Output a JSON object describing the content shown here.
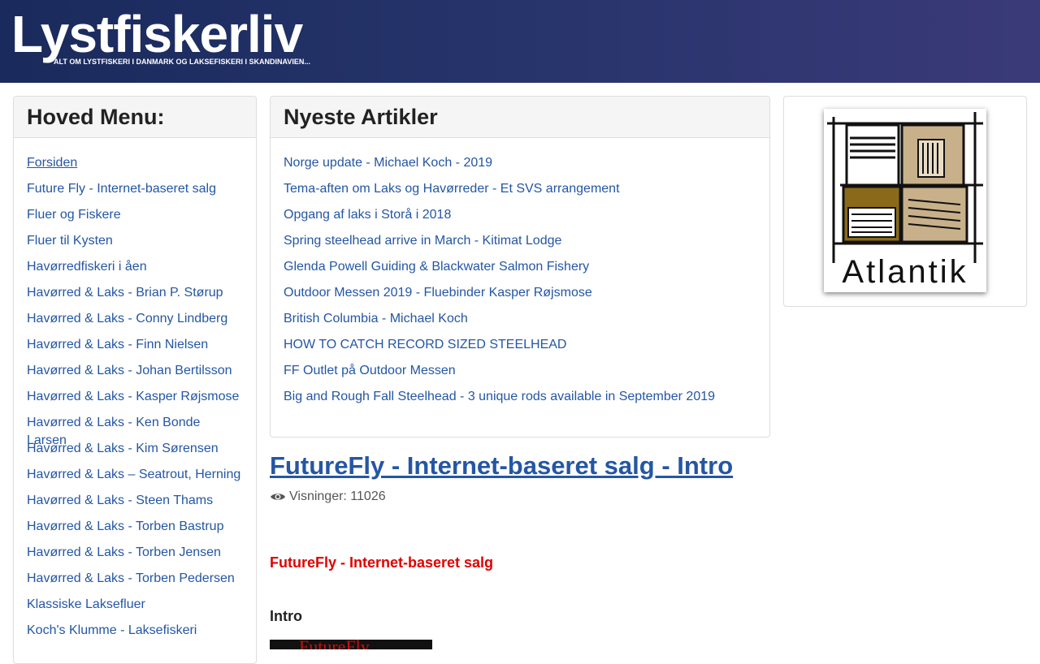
{
  "header": {
    "logo_title": "Lystfiskerliv",
    "logo_tagline": "ALT OM LYSTFISKERI I DANMARK OG LAKSEFISKERI I SKANDINAVIEN..."
  },
  "main_menu": {
    "title": "Hoved Menu:",
    "items": [
      "Forsiden",
      "Future Fly - Internet-baseret salg",
      "Fluer og Fiskere",
      "Fluer til Kysten",
      "Havørredfiskeri i åen",
      "Havørred & Laks - Brian P. Størup",
      "Havørred & Laks - Conny Lindberg",
      "Havørred & Laks - Finn Nielsen",
      "Havørred & Laks - Johan Bertilsson",
      "Havørred & Laks - Kasper Røjsmose",
      "Havørred & Laks - Ken Bonde Larsen",
      "Havørred & Laks - Kim Sørensen",
      "Havørred & Laks – Seatrout, Herning",
      "Havørred & Laks - Steen Thams",
      "Havørred & Laks - Torben Bastrup",
      "Havørred & Laks - Torben Jensen",
      "Havørred & Laks - Torben Pedersen",
      "Klassiske Laksefluer",
      "Koch's Klumme - Laksefiskeri"
    ]
  },
  "latest_articles": {
    "title": "Nyeste Artikler",
    "items": [
      "Norge update - Michael Koch - 2019",
      "Tema-aften om Laks og Havørreder - Et SVS arrangement",
      "Opgang af laks i Storå i 2018",
      "Spring steelhead arrive in March - Kitimat Lodge",
      "Glenda Powell Guiding & Blackwater Salmon Fishery",
      "Outdoor Messen 2019 - Fluebinder Kasper Røjsmose",
      "British Columbia - Michael Koch",
      "HOW TO CATCH RECORD SIZED STEELHEAD",
      "FF Outlet på Outdoor Messen",
      "Big and Rough Fall Steelhead - 3 unique rods available in September 2019"
    ]
  },
  "sponsor": {
    "logo_text": "Atlantik"
  },
  "article": {
    "title": "FutureFly - Internet-baseret salg - Intro",
    "views_label": "Visninger: 11026",
    "subheading": "FutureFly - Internet-baseret salg",
    "section_heading": "Intro",
    "image_text": "FutureFly"
  },
  "colors": {
    "link": "#2456a4",
    "header_bg": "#1a2a5c",
    "subheading_red": "#e00000"
  }
}
